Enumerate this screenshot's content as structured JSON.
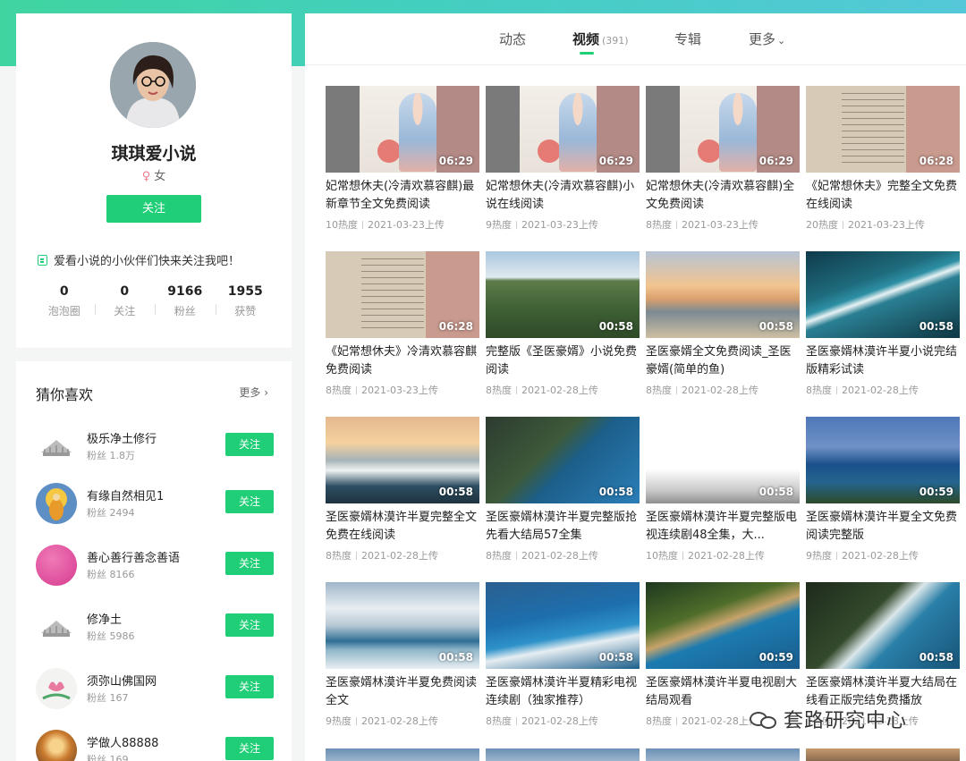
{
  "profile": {
    "name": "琪琪爱小说",
    "gender": "女",
    "follow_label": "关注",
    "bio": "爱看小说的小伙伴们快来关注我吧！",
    "stats": [
      {
        "num": "0",
        "label": "泡泡圈"
      },
      {
        "num": "0",
        "label": "关注"
      },
      {
        "num": "9166",
        "label": "粉丝"
      },
      {
        "num": "1955",
        "label": "获赞"
      }
    ]
  },
  "recommend": {
    "title": "猜你喜欢",
    "more": "更多",
    "items": [
      {
        "name": "极乐净土修行",
        "fans": "粉丝 1.8万",
        "follow": "关注"
      },
      {
        "name": "有缘自然相见1",
        "fans": "粉丝 2494",
        "follow": "关注"
      },
      {
        "name": "善心善行善念善语",
        "fans": "粉丝 8166",
        "follow": "关注"
      },
      {
        "name": "修净土",
        "fans": "粉丝 5986",
        "follow": "关注"
      },
      {
        "name": "须弥山佛国网",
        "fans": "粉丝 167",
        "follow": "关注"
      },
      {
        "name": "学做人88888",
        "fans": "粉丝 169",
        "follow": "关注"
      }
    ]
  },
  "tabs": {
    "dynamic": "动态",
    "video": "视频",
    "video_count": "(391)",
    "album": "专辑",
    "more": "更多"
  },
  "videos": [
    {
      "title": "妃常想休夫(冷清欢慕容麒)最新章节全文免费阅读",
      "heat": "10热度",
      "date": "2021-03-23上传",
      "duration": "06:29",
      "thumb": "novel"
    },
    {
      "title": "妃常想休夫(冷清欢慕容麒)小说在线阅读",
      "heat": "9热度",
      "date": "2021-03-23上传",
      "duration": "06:29",
      "thumb": "novel"
    },
    {
      "title": "妃常想休夫(冷清欢慕容麒)全文免费阅读",
      "heat": "8热度",
      "date": "2021-03-23上传",
      "duration": "06:29",
      "thumb": "novel"
    },
    {
      "title": "《妃常想休夫》完整全文免费在线阅读",
      "heat": "20热度",
      "date": "2021-03-23上传",
      "duration": "06:28",
      "thumb": "text"
    },
    {
      "title": "《妃常想休夫》冷清欢慕容麒免费阅读",
      "heat": "8热度",
      "date": "2021-03-23上传",
      "duration": "06:28",
      "thumb": "text"
    },
    {
      "title": "完整版《圣医豪婿》小说免费阅读",
      "heat": "8热度",
      "date": "2021-02-28上传",
      "duration": "00:58",
      "thumb": "hills"
    },
    {
      "title": "圣医豪婿全文免费阅读_圣医豪婿(简单的鱼)",
      "heat": "8热度",
      "date": "2021-02-28上传",
      "duration": "00:58",
      "thumb": "beach-sunset"
    },
    {
      "title": "圣医豪婿林漠许半夏小说完结版精彩试读",
      "heat": "8热度",
      "date": "2021-02-28上传",
      "duration": "00:58",
      "thumb": "aerial-wave"
    },
    {
      "title": "圣医豪婿林漠许半夏完整全文免费在线阅读",
      "heat": "8热度",
      "date": "2021-02-28上传",
      "duration": "00:58",
      "thumb": "sunset-wave"
    },
    {
      "title": "圣医豪婿林漠许半夏完整版抢先看大结局57全集",
      "heat": "8热度",
      "date": "2021-02-28上传",
      "duration": "00:58",
      "thumb": "cliff"
    },
    {
      "title": "圣医豪婿林漠许半夏完整版电视连续剧48全集，大...",
      "heat": "10热度",
      "date": "2021-02-28上传",
      "duration": "00:58",
      "thumb": "fade"
    },
    {
      "title": "圣医豪婿林漠许半夏全文免费阅读完整版",
      "heat": "9热度",
      "date": "2021-02-28上传",
      "duration": "00:59",
      "thumb": "sea-cliff"
    },
    {
      "title": "圣医豪婿林漠许半夏免费阅读全文",
      "heat": "9热度",
      "date": "2021-02-28上传",
      "duration": "00:58",
      "thumb": "clouds"
    },
    {
      "title": "圣医豪婿林漠许半夏精彩电视连续剧（独家推荐）",
      "heat": "8热度",
      "date": "2021-02-28上传",
      "duration": "00:58",
      "thumb": "blue-bay"
    },
    {
      "title": "圣医豪婿林漠许半夏电视剧大结局观看",
      "heat": "8热度",
      "date": "2021-02-28上传",
      "duration": "00:59",
      "thumb": "coast"
    },
    {
      "title": "圣医豪婿林漠许半夏大结局在线看正版完结免费播放",
      "heat": "8热度",
      "date": "2021-02-28上传",
      "duration": "00:58",
      "thumb": "rocks"
    }
  ],
  "watermark": "套路研究中心",
  "colors": {
    "accent": "#1fce76",
    "header_gradient_start": "#3fd4a0",
    "header_gradient_end": "#54c8d8"
  }
}
